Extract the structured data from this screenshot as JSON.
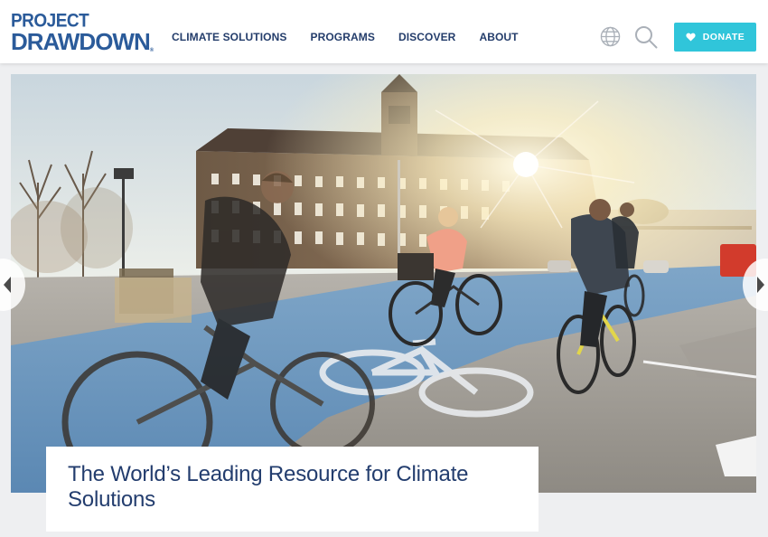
{
  "header": {
    "logo": {
      "line1": "PROJECT",
      "line2": "DRAWDOWN",
      "trademark": "®"
    },
    "nav": [
      {
        "label": "CLIMATE SOLUTIONS"
      },
      {
        "label": "PROGRAMS"
      },
      {
        "label": "DISCOVER"
      },
      {
        "label": "ABOUT"
      }
    ],
    "icons": {
      "language": "globe-icon",
      "search": "search-icon"
    },
    "donate": {
      "label": "DONATE",
      "icon": "heart-icon"
    }
  },
  "hero": {
    "image_description_icon": "hero-photo",
    "headline": "The World’s Leading Resource for Climate Solutions"
  },
  "colors": {
    "brand_blue": "#2b5b9a",
    "nav_text": "#243d6b",
    "donate_bg": "#30c5da",
    "headline": "#233d6e",
    "page_bg": "#eeeff1"
  }
}
